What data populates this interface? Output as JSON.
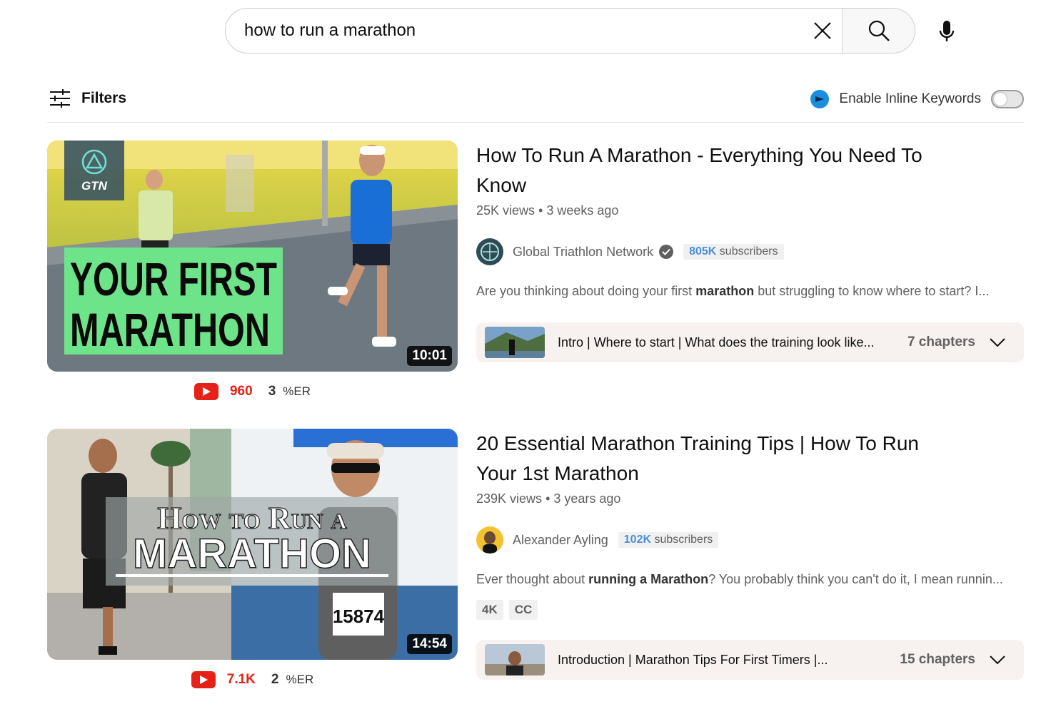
{
  "search": {
    "query": "how to run a marathon"
  },
  "filters": {
    "label": "Filters"
  },
  "inline_keywords": {
    "label": "Enable Inline Keywords",
    "enabled": false
  },
  "results": [
    {
      "title": "How To Run A Marathon - Everything You Need To Know",
      "views": "25K views",
      "age": "3 weeks ago",
      "duration": "10:01",
      "thumb_text": [
        "YOUR FIRST",
        "MARATHON"
      ],
      "thumb_logo": "GTN",
      "channel": "Global Triathlon Network",
      "verified": true,
      "subs_count": "805K",
      "subs_label": "subscribers",
      "desc_before": "Are you thinking about doing your first ",
      "desc_bold": "marathon",
      "desc_after": " but struggling to know where to start? I...",
      "chapters_text": "Intro | Where to start | What does the training look like...",
      "chapters_count": "7 chapters",
      "stat_views": "960",
      "stat_er": "3",
      "stat_er_unit": "%ER"
    },
    {
      "title": "20 Essential Marathon Training Tips | How To Run Your 1st Marathon",
      "views": "239K views",
      "age": "3 years ago",
      "duration": "14:54",
      "thumb_text": [
        "How to Run a",
        "MARATHON"
      ],
      "thumb_bib": "15874",
      "channel": "Alexander Ayling",
      "verified": false,
      "subs_count": "102K",
      "subs_label": "subscribers",
      "desc_before": "Ever thought about ",
      "desc_bold": "running a Marathon",
      "desc_after": "? You probably think you can't do it, I mean runnin...",
      "badges": [
        "4K",
        "CC"
      ],
      "chapters_text": "Introduction | Marathon Tips For First Timers |...",
      "chapters_count": "15 chapters",
      "stat_views": "7.1K",
      "stat_er": "2",
      "stat_er_unit": "%ER"
    }
  ],
  "colors": {
    "yt_red": "#e62117",
    "subs_blue": "#4a90d9",
    "thumb_green": "#6de38a"
  }
}
